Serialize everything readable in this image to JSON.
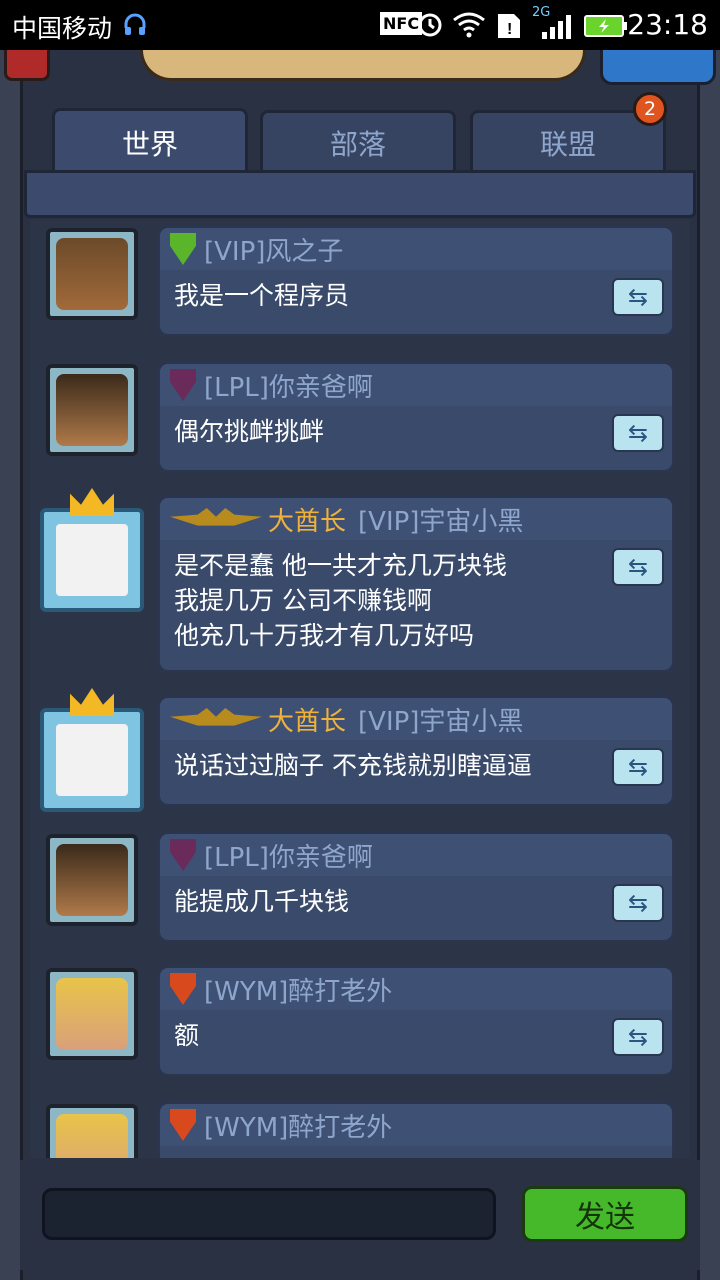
{
  "status_bar": {
    "carrier": "中国移动",
    "network": "2G",
    "time": "23:18",
    "icons": [
      "headset-icon",
      "nfc-icon",
      "alarm-icon",
      "wifi-icon",
      "sim-alert-icon",
      "signal-icon",
      "battery-icon"
    ]
  },
  "tabs": [
    {
      "label": "世界",
      "active": true
    },
    {
      "label": "部落",
      "active": false
    },
    {
      "label": "联盟",
      "active": false
    }
  ],
  "alliance_badge": "2",
  "messages": [
    {
      "tag": "[VIP]风之子",
      "rank_color": "#5ab52a",
      "text": "我是一个程序员",
      "avatar": "bearded-warrior"
    },
    {
      "tag": "[LPL]你亲爸啊",
      "rank_color": "#6a2a5a",
      "text": "偶尔挑衅挑衅",
      "avatar": "long-hair-warrior"
    },
    {
      "chief": "大酋长",
      "tag": "[VIP]宇宙小黑",
      "lines": [
        "是不是蠢 他一共才充几万块钱",
        "我提几万 公司不赚钱啊",
        "他充几十万我才有几万好吗"
      ],
      "avatar": "meme-face"
    },
    {
      "chief": "大酋长",
      "tag": "[VIP]宇宙小黑",
      "text": "说话过过脑子 不充钱就别瞎逼逼",
      "avatar": "meme-face"
    },
    {
      "tag": "[LPL]你亲爸啊",
      "rank_color": "#6a2a5a",
      "text": "能提成几千块钱",
      "avatar": "long-hair-warrior"
    },
    {
      "tag": "[WYM]醉打老外",
      "rank_color": "#d84a1e",
      "text": "额",
      "avatar": "blonde-woman"
    },
    {
      "tag": "[WYM]醉打老外",
      "rank_color": "#d84a1e",
      "text": "",
      "avatar": "blonde-woman"
    }
  ],
  "input": {
    "placeholder": "",
    "send_label": "发送"
  },
  "colors": {
    "accent_green": "#46b92a",
    "chief_gold": "#f0b23a",
    "tab_inactive": "#8fa6cc"
  }
}
